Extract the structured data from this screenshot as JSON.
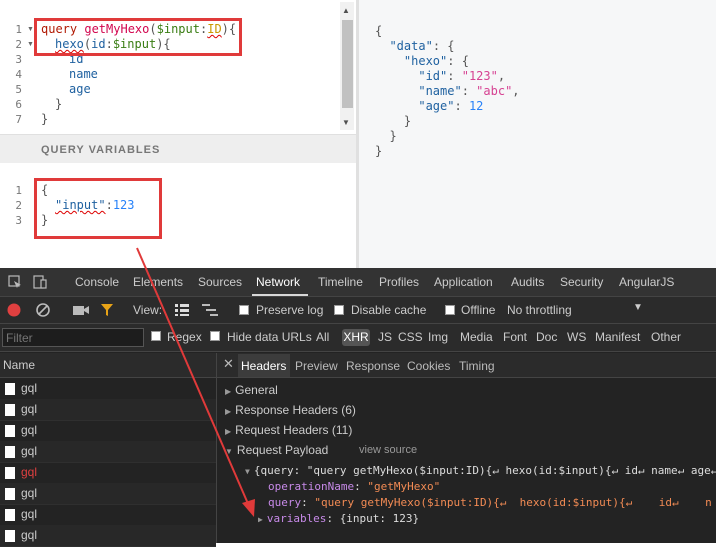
{
  "editor": {
    "line_numbers": [
      "1",
      "2",
      "3",
      "4",
      "5",
      "6",
      "7"
    ],
    "lines": {
      "l1_keyword": "query",
      "l1_name": "getMyHexo",
      "l1_open": "(",
      "l1_var": "$input",
      "l1_colon": ":",
      "l1_type": "ID",
      "l1_close": "){",
      "l2_field": "hexo",
      "l2_open": "(",
      "l2_arg": "id",
      "l2_colon": ":",
      "l2_var": "$input",
      "l2_close": "){",
      "l3": "id",
      "l4": "name",
      "l5": "age",
      "l6": "}",
      "l7": "}"
    }
  },
  "query_variables": {
    "title": "QUERY VARIABLES",
    "line_numbers": [
      "1",
      "2",
      "3"
    ],
    "l1": "{",
    "l2_key": "\"input\"",
    "l2_colon": ":",
    "l2_value": "123",
    "l3": "}"
  },
  "result": {
    "lines": [
      {
        "indent": "",
        "key": "",
        "sep": "{",
        "value": "",
        "tail": ""
      },
      {
        "indent": "  ",
        "key": "\"data\"",
        "sep": ": {",
        "value": "",
        "tail": ""
      },
      {
        "indent": "    ",
        "key": "\"hexo\"",
        "sep": ": {",
        "value": "",
        "tail": ""
      },
      {
        "indent": "      ",
        "key": "\"id\"",
        "sep": ": ",
        "value": "\"123\"",
        "tail": ","
      },
      {
        "indent": "      ",
        "key": "\"name\"",
        "sep": ": ",
        "value": "\"abc\"",
        "tail": ","
      },
      {
        "indent": "      ",
        "key": "\"age\"",
        "sep": ": ",
        "value": "12",
        "tail": ""
      },
      {
        "indent": "    ",
        "key": "",
        "sep": "}",
        "value": "",
        "tail": ""
      },
      {
        "indent": "  ",
        "key": "",
        "sep": "}",
        "value": "",
        "tail": ""
      },
      {
        "indent": "",
        "key": "",
        "sep": "}",
        "value": "",
        "tail": ""
      }
    ]
  },
  "devtools": {
    "tabs": [
      "Console",
      "Elements",
      "Sources",
      "Network",
      "Timeline",
      "Profiles",
      "Application",
      "Audits",
      "Security",
      "AngularJS"
    ],
    "active_tab": "Network",
    "toolbar": {
      "view_label": "View:",
      "preserve_log": "Preserve log",
      "disable_cache": "Disable cache",
      "offline": "Offline",
      "throttling": "No throttling"
    },
    "filter": {
      "placeholder": "Filter",
      "regex": "Regex",
      "hide_data_urls": "Hide data URLs",
      "types": [
        "All",
        "XHR",
        "JS",
        "CSS",
        "Img",
        "Media",
        "Font",
        "Doc",
        "WS",
        "Manifest",
        "Other"
      ]
    },
    "name_header": "Name",
    "requests": [
      "gql",
      "gql",
      "gql",
      "gql",
      "gql",
      "gql",
      "gql",
      "gql"
    ],
    "detail_tabs": [
      "Headers",
      "Preview",
      "Response",
      "Cookies",
      "Timing"
    ],
    "sections": {
      "general": "General",
      "response_headers": "Response Headers (6)",
      "request_headers": "Request Headers (11)",
      "request_payload": "Request Payload",
      "view_source": "view source"
    },
    "payload": {
      "root": "{query: \"query getMyHexo($input:ID){↵ hexo(id:$input){↵ id↵ name↵ age↵",
      "operation_key": "operationName",
      "operation_value": "\"getMyHexo\"",
      "query_key": "query",
      "query_value": "\"query getMyHexo($input:ID){↵  hexo(id:$input){↵    id↵    n",
      "variables_key": "variables",
      "variables_value": "{input: 123}"
    }
  },
  "colors": {
    "highlight_box": "#e03a3a",
    "arrow": "#e03a3a",
    "devtools_bg": "#232323"
  }
}
